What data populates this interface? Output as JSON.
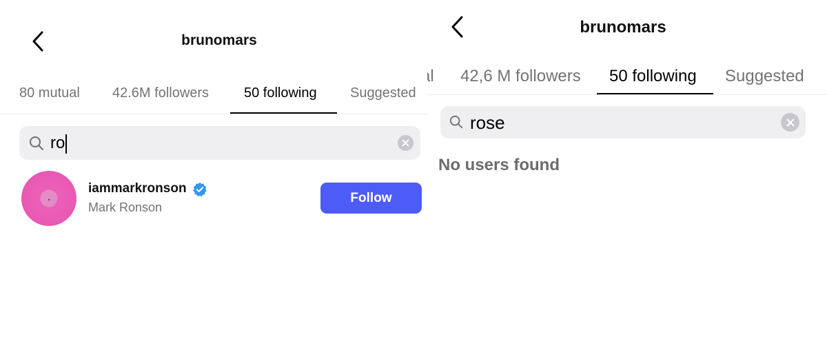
{
  "left": {
    "header": {
      "title": "brunomars"
    },
    "tabs": [
      {
        "label": "80 mutual"
      },
      {
        "label": "42.6M followers"
      },
      {
        "label": "50 following"
      },
      {
        "label": "Suggested"
      }
    ],
    "search": {
      "value": "ro"
    },
    "results": [
      {
        "username": "iammarkronson",
        "full_name": "Mark Ronson",
        "verified": true,
        "button_label": "Follow"
      }
    ]
  },
  "right": {
    "header": {
      "title": "brunomars"
    },
    "tabs": [
      {
        "label": "al"
      },
      {
        "label": "42,6 M followers"
      },
      {
        "label": "50 following"
      },
      {
        "label": "Suggested"
      }
    ],
    "search": {
      "value": "rose"
    },
    "empty_message": "No users found"
  },
  "colors": {
    "accent": "#4d5cf8",
    "verified": "#3797f0",
    "avatar": "#ec5fb8"
  }
}
